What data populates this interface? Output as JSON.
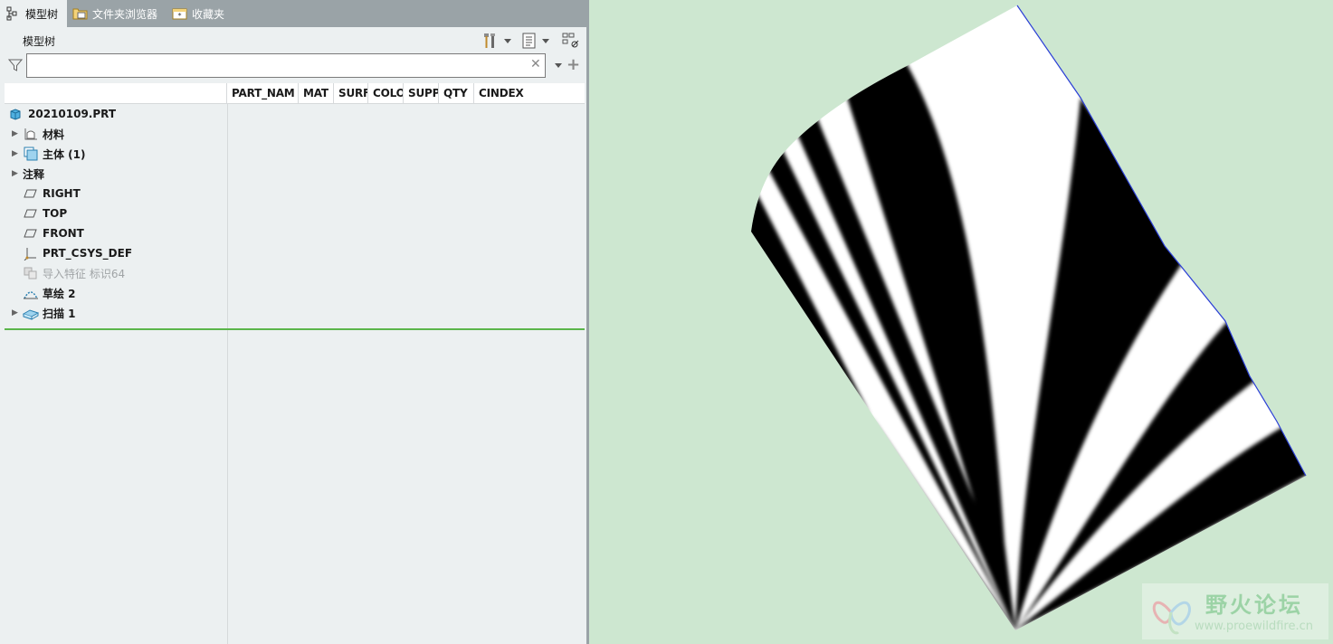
{
  "tabs": [
    {
      "label": "模型树",
      "icon": "model-tree-icon",
      "active": true
    },
    {
      "label": "文件夹浏览器",
      "icon": "folder-browser-icon",
      "active": false
    },
    {
      "label": "收藏夹",
      "icon": "favorites-icon",
      "active": false
    }
  ],
  "tree_header": {
    "title": "模型树"
  },
  "search": {
    "value": "",
    "placeholder": ""
  },
  "columns": [
    "PART_NAM",
    "MAT",
    "SURF",
    "COLO",
    "SUPP",
    "QTY",
    "CINDEX"
  ],
  "tree": {
    "root": {
      "label": "20210109.PRT",
      "icon": "part-icon"
    },
    "items": [
      {
        "label": "材料",
        "icon": "material-icon",
        "expandable": true,
        "dim": false
      },
      {
        "label": "主体 (1)",
        "icon": "body-icon",
        "expandable": true,
        "dim": false
      },
      {
        "label": "注释",
        "icon": "",
        "expandable": true,
        "dim": false
      },
      {
        "label": "RIGHT",
        "icon": "datum-plane-icon",
        "expandable": false,
        "dim": false
      },
      {
        "label": "TOP",
        "icon": "datum-plane-icon",
        "expandable": false,
        "dim": false
      },
      {
        "label": "FRONT",
        "icon": "datum-plane-icon",
        "expandable": false,
        "dim": false
      },
      {
        "label": "PRT_CSYS_DEF",
        "icon": "csys-icon",
        "expandable": false,
        "dim": false
      },
      {
        "label": "导入特征 标识64",
        "icon": "import-feature-icon",
        "expandable": false,
        "dim": true
      },
      {
        "label": "草绘 2",
        "icon": "sketch-icon",
        "expandable": false,
        "dim": false
      },
      {
        "label": "扫描 1",
        "icon": "sweep-icon",
        "expandable": true,
        "dim": false
      }
    ]
  },
  "watermark": {
    "text": "野火论坛",
    "url": "www.proewildfire.cn"
  },
  "colors": {
    "viewport_bg": "#cde7d0",
    "panel_bg": "#ecf0f1",
    "tab_bar": "#9aa3a7",
    "insert_line": "#5bb54a",
    "edge_highlight": "#2b3fd6"
  }
}
